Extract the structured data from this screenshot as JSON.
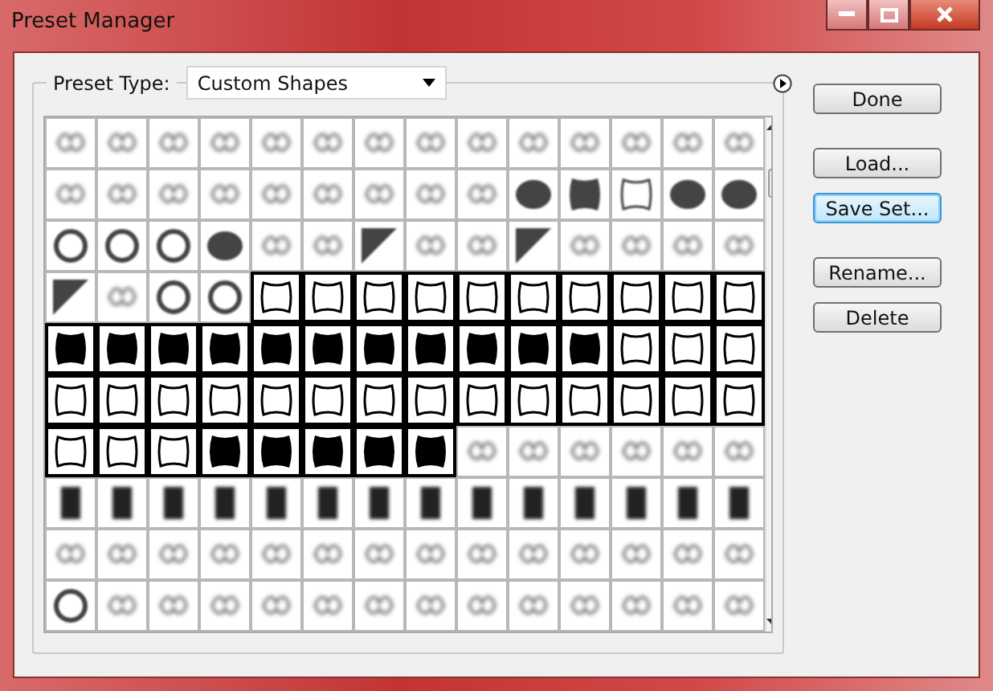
{
  "window": {
    "title": "Preset Manager"
  },
  "preset_type": {
    "label": "Preset Type:",
    "value": "Custom Shapes"
  },
  "grid": {
    "rows": [
      {
        "tiles": [
          {
            "kind": "faint",
            "selected": false
          },
          {
            "kind": "faint",
            "selected": false
          },
          {
            "kind": "faint",
            "selected": false
          },
          {
            "kind": "faint",
            "selected": false
          },
          {
            "kind": "faint",
            "selected": false
          },
          {
            "kind": "faint",
            "selected": false
          },
          {
            "kind": "faint",
            "selected": false
          },
          {
            "kind": "faint",
            "selected": false
          },
          {
            "kind": "faint",
            "selected": false
          },
          {
            "kind": "faint",
            "selected": false
          },
          {
            "kind": "faint",
            "selected": false
          },
          {
            "kind": "faint",
            "selected": false
          },
          {
            "kind": "faint",
            "selected": false
          },
          {
            "kind": "faint",
            "selected": false
          }
        ]
      },
      {
        "tiles": [
          {
            "kind": "faint",
            "selected": false
          },
          {
            "kind": "faint",
            "selected": false
          },
          {
            "kind": "faint",
            "selected": false
          },
          {
            "kind": "faint",
            "selected": false
          },
          {
            "kind": "faint",
            "selected": false
          },
          {
            "kind": "faint",
            "selected": false
          },
          {
            "kind": "faint",
            "selected": false
          },
          {
            "kind": "faint",
            "selected": false
          },
          {
            "kind": "faint",
            "selected": false
          },
          {
            "kind": "blob",
            "selected": false
          },
          {
            "kind": "plaque",
            "selected": false
          },
          {
            "kind": "frame",
            "selected": false
          },
          {
            "kind": "blob",
            "selected": false
          },
          {
            "kind": "blob",
            "selected": false
          }
        ]
      },
      {
        "tiles": [
          {
            "kind": "ring",
            "selected": false
          },
          {
            "kind": "ring",
            "selected": false
          },
          {
            "kind": "ring",
            "selected": false
          },
          {
            "kind": "blob",
            "selected": false
          },
          {
            "kind": "faint",
            "selected": false
          },
          {
            "kind": "faint",
            "selected": false
          },
          {
            "kind": "corner",
            "selected": false
          },
          {
            "kind": "faint",
            "selected": false
          },
          {
            "kind": "faint",
            "selected": false
          },
          {
            "kind": "corner",
            "selected": false
          },
          {
            "kind": "faint",
            "selected": false
          },
          {
            "kind": "faint",
            "selected": false
          },
          {
            "kind": "faint",
            "selected": false
          },
          {
            "kind": "faint",
            "selected": false
          }
        ]
      },
      {
        "tiles": [
          {
            "kind": "corner",
            "selected": false
          },
          {
            "kind": "faint",
            "selected": false
          },
          {
            "kind": "ring",
            "selected": false
          },
          {
            "kind": "ring",
            "selected": false
          },
          {
            "kind": "frame",
            "selected": true
          },
          {
            "kind": "frame",
            "selected": true
          },
          {
            "kind": "frame",
            "selected": true
          },
          {
            "kind": "frame",
            "selected": true
          },
          {
            "kind": "frame",
            "selected": true
          },
          {
            "kind": "frame",
            "selected": true
          },
          {
            "kind": "frame",
            "selected": true
          },
          {
            "kind": "frame",
            "selected": true
          },
          {
            "kind": "frame",
            "selected": true
          },
          {
            "kind": "frame",
            "selected": true
          }
        ]
      },
      {
        "tiles": [
          {
            "kind": "plaque",
            "selected": true
          },
          {
            "kind": "plaque",
            "selected": true
          },
          {
            "kind": "plaque",
            "selected": true
          },
          {
            "kind": "plaque",
            "selected": true
          },
          {
            "kind": "plaque",
            "selected": true
          },
          {
            "kind": "plaque",
            "selected": true
          },
          {
            "kind": "plaque",
            "selected": true
          },
          {
            "kind": "plaque",
            "selected": true
          },
          {
            "kind": "plaque",
            "selected": true
          },
          {
            "kind": "plaque",
            "selected": true
          },
          {
            "kind": "plaque",
            "selected": true
          },
          {
            "kind": "frame",
            "selected": true
          },
          {
            "kind": "frame",
            "selected": true
          },
          {
            "kind": "frame",
            "selected": true
          }
        ]
      },
      {
        "tiles": [
          {
            "kind": "frame",
            "selected": true
          },
          {
            "kind": "frame",
            "selected": true
          },
          {
            "kind": "frame",
            "selected": true
          },
          {
            "kind": "frame",
            "selected": true
          },
          {
            "kind": "frame",
            "selected": true
          },
          {
            "kind": "frame",
            "selected": true
          },
          {
            "kind": "frame",
            "selected": true
          },
          {
            "kind": "frame",
            "selected": true
          },
          {
            "kind": "frame",
            "selected": true
          },
          {
            "kind": "frame",
            "selected": true
          },
          {
            "kind": "frame",
            "selected": true
          },
          {
            "kind": "frame",
            "selected": true
          },
          {
            "kind": "frame",
            "selected": true
          },
          {
            "kind": "frame",
            "selected": true
          }
        ]
      },
      {
        "tiles": [
          {
            "kind": "frame",
            "selected": true
          },
          {
            "kind": "frame",
            "selected": true
          },
          {
            "kind": "frame",
            "selected": true
          },
          {
            "kind": "plaque",
            "selected": true
          },
          {
            "kind": "plaque",
            "selected": true
          },
          {
            "kind": "plaque",
            "selected": true
          },
          {
            "kind": "plaque",
            "selected": true
          },
          {
            "kind": "plaque",
            "selected": true
          },
          {
            "kind": "faint",
            "selected": false
          },
          {
            "kind": "faint",
            "selected": false
          },
          {
            "kind": "faint",
            "selected": false
          },
          {
            "kind": "faint",
            "selected": false
          },
          {
            "kind": "faint",
            "selected": false
          },
          {
            "kind": "faint",
            "selected": false
          }
        ]
      },
      {
        "tiles": [
          {
            "kind": "bar",
            "selected": false
          },
          {
            "kind": "bar",
            "selected": false
          },
          {
            "kind": "bar",
            "selected": false
          },
          {
            "kind": "bar",
            "selected": false
          },
          {
            "kind": "bar",
            "selected": false
          },
          {
            "kind": "bar",
            "selected": false
          },
          {
            "kind": "bar",
            "selected": false
          },
          {
            "kind": "bar",
            "selected": false
          },
          {
            "kind": "bar",
            "selected": false
          },
          {
            "kind": "bar",
            "selected": false
          },
          {
            "kind": "bar",
            "selected": false
          },
          {
            "kind": "bar",
            "selected": false
          },
          {
            "kind": "bar",
            "selected": false
          },
          {
            "kind": "bar",
            "selected": false
          }
        ]
      },
      {
        "tiles": [
          {
            "kind": "faint",
            "selected": false
          },
          {
            "kind": "faint",
            "selected": false
          },
          {
            "kind": "faint",
            "selected": false
          },
          {
            "kind": "faint",
            "selected": false
          },
          {
            "kind": "faint",
            "selected": false
          },
          {
            "kind": "faint",
            "selected": false
          },
          {
            "kind": "faint",
            "selected": false
          },
          {
            "kind": "faint",
            "selected": false
          },
          {
            "kind": "faint",
            "selected": false
          },
          {
            "kind": "faint",
            "selected": false
          },
          {
            "kind": "faint",
            "selected": false
          },
          {
            "kind": "faint",
            "selected": false
          },
          {
            "kind": "faint",
            "selected": false
          },
          {
            "kind": "faint",
            "selected": false
          }
        ]
      },
      {
        "tiles": [
          {
            "kind": "ring",
            "selected": false
          },
          {
            "kind": "faint",
            "selected": false
          },
          {
            "kind": "faint",
            "selected": false
          },
          {
            "kind": "faint",
            "selected": false
          },
          {
            "kind": "faint",
            "selected": false
          },
          {
            "kind": "faint",
            "selected": false
          },
          {
            "kind": "faint",
            "selected": false
          },
          {
            "kind": "faint",
            "selected": false
          },
          {
            "kind": "faint",
            "selected": false
          },
          {
            "kind": "faint",
            "selected": false
          },
          {
            "kind": "faint",
            "selected": false
          },
          {
            "kind": "faint",
            "selected": false
          },
          {
            "kind": "faint",
            "selected": false
          },
          {
            "kind": "faint",
            "selected": false
          }
        ]
      }
    ]
  },
  "button_groups": [
    {
      "buttons": [
        {
          "label": "Done",
          "focused": false
        }
      ]
    },
    {
      "buttons": [
        {
          "label": "Load...",
          "focused": false
        },
        {
          "label": "Save Set...",
          "focused": true
        }
      ]
    },
    {
      "buttons": [
        {
          "label": "Rename...",
          "focused": false
        },
        {
          "label": "Delete",
          "focused": false
        }
      ]
    }
  ]
}
